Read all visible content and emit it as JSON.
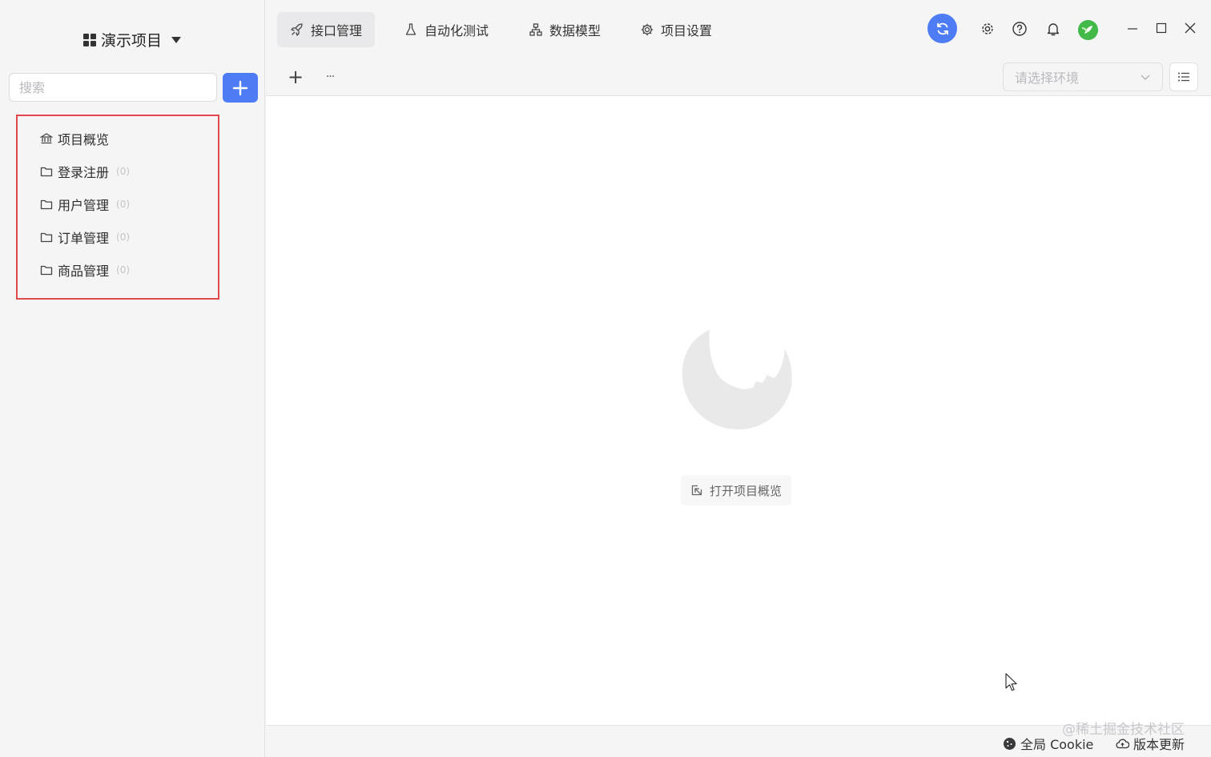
{
  "sidebar": {
    "project_name": "演示项目",
    "search_placeholder": "搜索",
    "tree": [
      {
        "label": "项目概览",
        "count": ""
      },
      {
        "label": "登录注册",
        "count": "(0)"
      },
      {
        "label": "用户管理",
        "count": "(0)"
      },
      {
        "label": "订单管理",
        "count": "(0)"
      },
      {
        "label": "商品管理",
        "count": "(0)"
      }
    ]
  },
  "header": {
    "tabs": [
      {
        "label": "接口管理",
        "icon": "rocket-icon",
        "active": true
      },
      {
        "label": "自动化测试",
        "icon": "flask-icon",
        "active": false
      },
      {
        "label": "数据模型",
        "icon": "hierarchy-icon",
        "active": false
      },
      {
        "label": "项目设置",
        "icon": "gear-icon",
        "active": false
      }
    ]
  },
  "toolbar": {
    "add_symbol": "+",
    "more_symbol": "···",
    "env_placeholder": "请选择环境"
  },
  "main": {
    "open_overview_label": "打开项目概览"
  },
  "statusbar": {
    "cookie_label": "全局 Cookie",
    "update_label": "版本更新",
    "watermark": "@稀土掘金技术社区"
  },
  "colors": {
    "accent": "#4e7cf4",
    "highlight_border": "#e0484b",
    "avatar": "#43b949"
  }
}
